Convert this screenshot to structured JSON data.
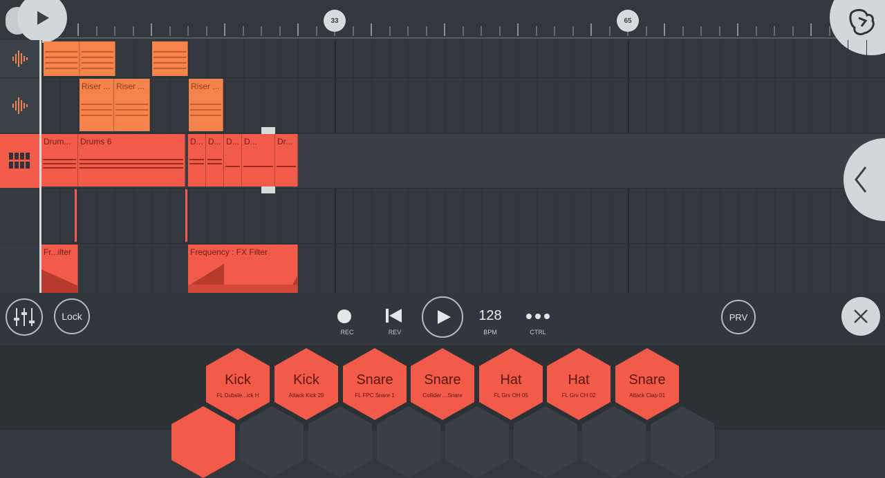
{
  "ruler": {
    "markers": [
      {
        "label": "33"
      },
      {
        "label": "65"
      }
    ]
  },
  "tracks": [
    {
      "type": "audio",
      "icon": "waveform-icon",
      "clips": [
        {
          "label": ""
        },
        {
          "label": ""
        },
        {
          "label": ""
        }
      ]
    },
    {
      "type": "audio",
      "icon": "waveform-icon",
      "clips": [
        {
          "label": "Riser ..."
        },
        {
          "label": "Riser ..."
        },
        {
          "label": "Riser ..."
        }
      ]
    },
    {
      "type": "pattern",
      "icon": "step-sequencer-icon",
      "clips": [
        {
          "label": "Drum..."
        },
        {
          "label": "Drums 6"
        },
        {
          "label": "D..."
        },
        {
          "label": "D..."
        },
        {
          "label": "D..."
        },
        {
          "label": "D..."
        },
        {
          "label": "Dr..."
        }
      ]
    },
    {
      "type": "automation",
      "icon": "",
      "clips": []
    },
    {
      "type": "automation",
      "icon": "",
      "clips": [
        {
          "label": "Fr...ilter"
        },
        {
          "label": "Frequency : FX Filter"
        }
      ]
    }
  ],
  "transport": {
    "lock_label": "Lock",
    "rec_label": "REC",
    "rev_label": "REV",
    "bpm_value": "128",
    "bpm_label": "BPM",
    "ctrl_label": "CTRL",
    "prv_label": "PRV"
  },
  "pads": [
    {
      "name": "Kick",
      "sample": "FL Dubste...ick H"
    },
    {
      "name": "Kick",
      "sample": "Attack Kick 29"
    },
    {
      "name": "Snare",
      "sample": "FL FPC Snare 1"
    },
    {
      "name": "Snare",
      "sample": "Collider ...Snare"
    },
    {
      "name": "Hat",
      "sample": "FL Grv OH 05"
    },
    {
      "name": "Hat",
      "sample": "FL Grv CH 02"
    },
    {
      "name": "Snare",
      "sample": "Attack Clap 01"
    }
  ],
  "colors": {
    "accent": "#f25a4a",
    "audio_clip": "#f4844c",
    "background": "#32383d"
  }
}
